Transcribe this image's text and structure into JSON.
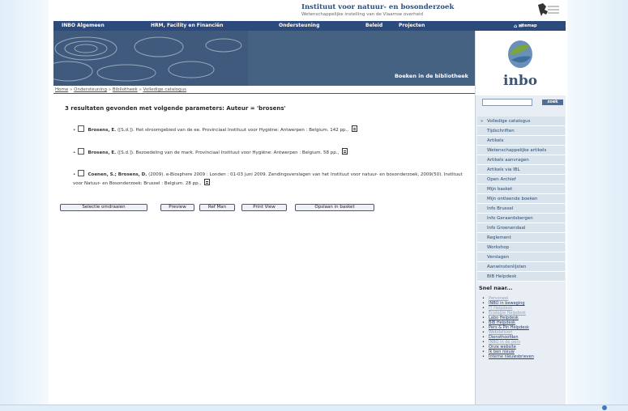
{
  "header": {
    "institute_name": "Instituut voor natuur- en bosonderzoek",
    "institute_sub": "Wetenschappelijke instelling van de Vlaamse overheid"
  },
  "nav": {
    "items": [
      "INBO Algemeen",
      "HRM, Facility en Financiën",
      "Ondersteuning",
      "Beleid",
      "Projecten"
    ],
    "sitemap": "sitemap"
  },
  "banner": {
    "title": "Boeken in de bibliotheek"
  },
  "logo": {
    "text": "inbo"
  },
  "breadcrumb": [
    "Home",
    "Ondersteuning",
    "Bibliotheek",
    "Volledige catalogus"
  ],
  "results": {
    "title": "3 resultaten gevonden met volgende parameters: Auteur = 'brosens'",
    "items": [
      {
        "author": "Brosens, E.",
        "text": "([S.d.]). Het stroomgebied van de ee. Provinciaal Instituut voor Hygiëne: Antwerpen : Belgium. 142 pp.,"
      },
      {
        "author": "Brosens, E.",
        "text": "([S.d.]). Bezoedeling van de mark. Provinciaal Instituut voor Hygiëne: Antwerpen : Belgium. 58 pp.,"
      },
      {
        "author": "Coenen, S.; Brosens, D.",
        "text": "(2009). e-Biosphere 2009 : Londen : 01-03 juni 2009. Zendingsverslagen van het Instituut voor natuur- en bosonderzoek, 2009(50). Instituut voor Natuur- en Bosonderzoek: Brussel : Belgium. 28 pp.,"
      }
    ]
  },
  "buttons": {
    "selectie": "Selectie omdraaien",
    "preview": "Preview",
    "refman": "Ref Man",
    "print": "Print View",
    "basket": "Opslaan in basket"
  },
  "sidebar": {
    "search_button": "zoek",
    "menu": [
      "Volledige catalogus",
      "Tijdschriften",
      "Artikels",
      "Wetenschappelijke artikels",
      "Artikels aanvragen",
      "Artikels via IBL",
      "Open Archief",
      "Mijn basket",
      "Mijn ontleende boeken",
      "Info Brussel",
      "Info Geraardsbergen",
      "Info Groenendaal",
      "Reglement",
      "Workshop",
      "Verslagen",
      "Aanwinstenlijsten",
      "BIB Helpdesk"
    ],
    "zie_title": "Snel naar...",
    "links": [
      "Personeel",
      "INBO in beweging",
      "IT Helpdesk",
      "Ecologie Helpdesk",
      "Labo Helpdesk",
      "BIB Helpdesk",
      "Pers & Pin Helpdesk",
      "Webdeliveri",
      "Diensthoofden",
      "INBO in de pers",
      "Onze website",
      "Ik ben nieuw",
      "Interne nieuwsbrieven"
    ]
  }
}
